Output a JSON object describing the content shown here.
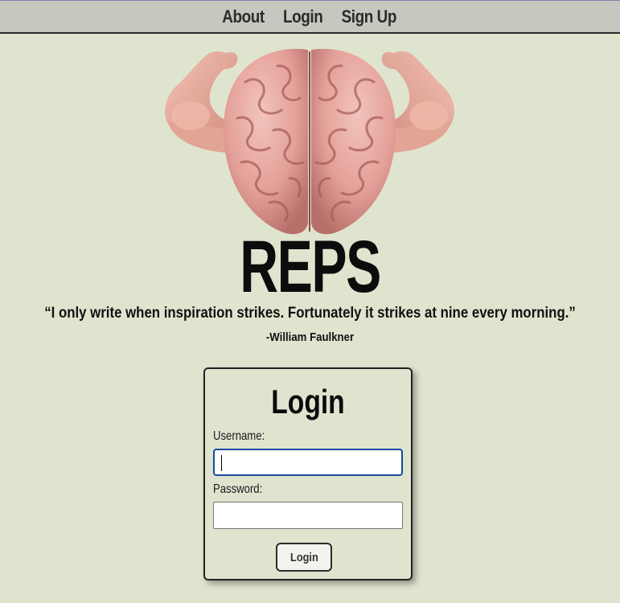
{
  "nav": {
    "items": [
      {
        "label": "About"
      },
      {
        "label": "Login"
      },
      {
        "label": "Sign Up"
      }
    ]
  },
  "hero": {
    "image": "muscular-brain-logo",
    "title": "REPS",
    "quote": "“I only write when inspiration strikes. Fortunately it strikes at nine every morning.”",
    "author": "-William Faulkner"
  },
  "login_form": {
    "heading": "Login",
    "username_label": "Username:",
    "username_value": "",
    "password_label": "Password:",
    "password_value": "",
    "submit_label": "Login"
  },
  "colors": {
    "background": "#dfe4cf",
    "nav_background": "#c4c8bf",
    "input_focus_border": "#1a4a9e",
    "brain": "#e7a8a0",
    "skin": "#e9b0a0"
  }
}
